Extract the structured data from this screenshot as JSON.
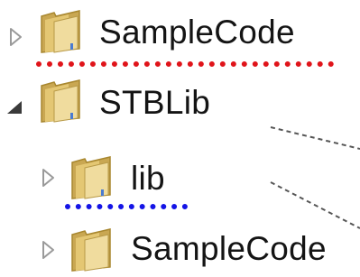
{
  "tree": {
    "items": [
      {
        "label": "SampleCode",
        "expander": "collapsed-triangle-icon",
        "icon": "folder-icon",
        "annotation_color": "#e0141a"
      },
      {
        "label": "STBLib",
        "expander": "expanded-triangle-icon",
        "icon": "folder-icon"
      },
      {
        "label": "lib",
        "expander": "collapsed-triangle-icon",
        "icon": "folder-icon",
        "annotation_color": "#1414e6"
      },
      {
        "label": "SampleCode",
        "expander": "collapsed-triangle-icon",
        "icon": "folder-icon"
      }
    ]
  },
  "colors": {
    "text": "#141414",
    "folder_body": "#e8cf7c",
    "folder_edge": "#b89a48",
    "red_annotation": "#e0141a",
    "blue_annotation": "#1414e6",
    "connector": "#555555"
  }
}
